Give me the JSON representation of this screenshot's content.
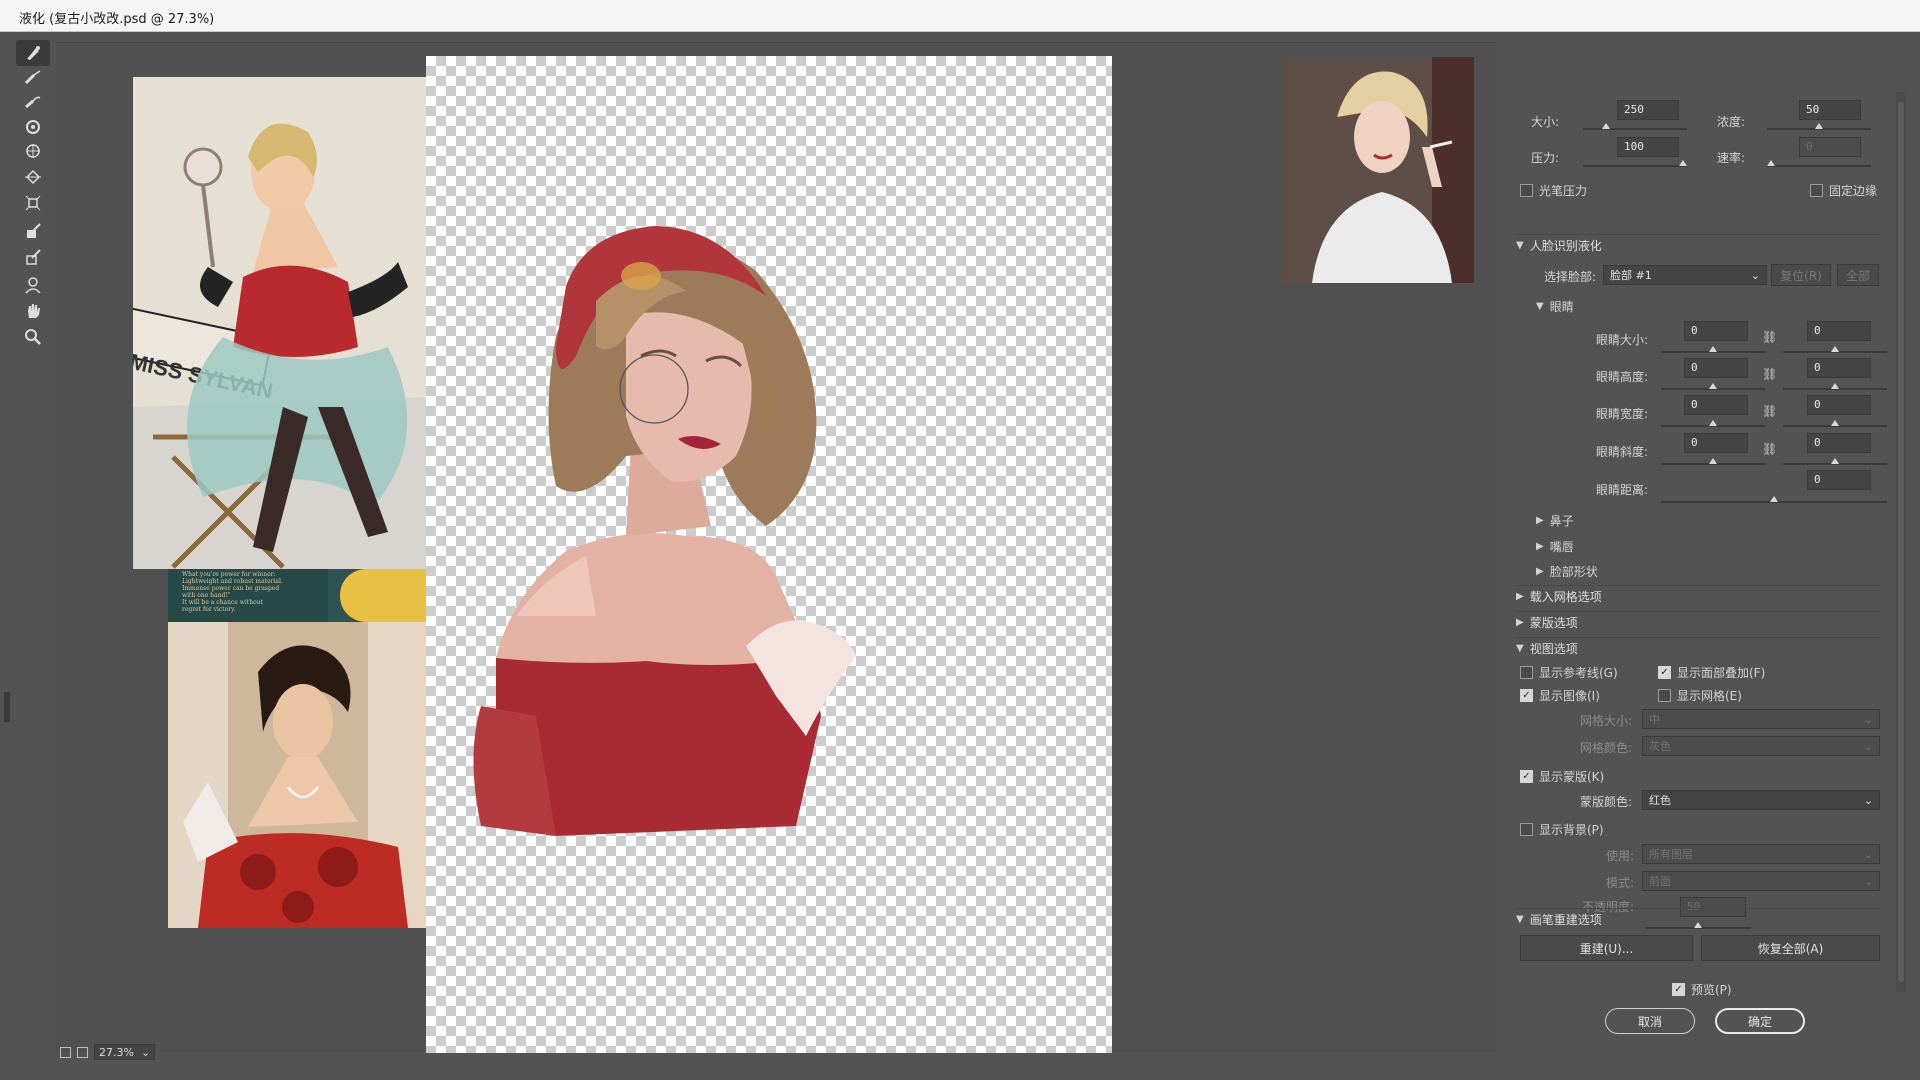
{
  "window": {
    "title": "液化 (复古小改改.psd @ 27.3%)"
  },
  "tools": [
    {
      "name": "forward-warp-tool"
    },
    {
      "name": "reconstruct-tool"
    },
    {
      "name": "smooth-tool"
    },
    {
      "name": "twirl-tool"
    },
    {
      "name": "pucker-tool"
    },
    {
      "name": "bloat-tool"
    },
    {
      "name": "push-left-tool"
    },
    {
      "name": "freeze-mask-tool"
    },
    {
      "name": "thaw-mask-tool"
    },
    {
      "name": "face-tool"
    },
    {
      "name": "hand-tool"
    },
    {
      "name": "zoom-tool"
    }
  ],
  "statusbar": {
    "zoom": "27.3%"
  },
  "brush": {
    "size_label": "大小:",
    "size_value": "250",
    "size_level": 0.2,
    "density_label": "浓度:",
    "density_value": "50",
    "density_level": 0.5,
    "pressure_label": "压力:",
    "pressure_value": "100",
    "pressure_level": 1.0,
    "rate_label": "速率:",
    "rate_value": "0",
    "rate_level": 0.0,
    "stylus_label": "光笔压力",
    "stylus_checked": false,
    "pin_edges_label": "固定边缘",
    "pin_edges_checked": false
  },
  "face": {
    "section": "人脸识别液化",
    "select_label": "选择脸部:",
    "select_value": "脸部 #1",
    "reset_label": "复位(R)",
    "all_label": "全部",
    "eyes_section": "眼睛",
    "eye_size_label": "眼睛大小:",
    "eye_size_left": "0",
    "eye_size_right": "0",
    "eye_height_label": "眼睛高度:",
    "eye_height_left": "0",
    "eye_height_right": "0",
    "eye_width_label": "眼睛宽度:",
    "eye_width_left": "0",
    "eye_width_right": "0",
    "eye_tilt_label": "眼睛斜度:",
    "eye_tilt_left": "0",
    "eye_tilt_right": "0",
    "eye_distance_label": "眼睛距离:",
    "eye_distance_value": "0",
    "nose": "鼻子",
    "mouth": "嘴唇",
    "face_shape": "脸部形状"
  },
  "mesh_section": "载入网格选项",
  "mask_section": "蒙版选项",
  "view": {
    "section": "视图选项",
    "guides_label": "显示参考线(G)",
    "guides_checked": false,
    "face_overlay_label": "显示面部叠加(F)",
    "face_overlay_checked": true,
    "image_label": "显示图像(I)",
    "image_checked": true,
    "mesh_label": "显示网格(E)",
    "mesh_checked": false,
    "mesh_size_label": "网格大小:",
    "mesh_size_value": "中",
    "mesh_color_label": "网格颜色:",
    "mesh_color_value": "灰色",
    "mask_label": "显示蒙版(K)",
    "mask_checked": true,
    "mask_color_label": "蒙版颜色:",
    "mask_color_value": "红色",
    "bg_label": "显示背景(P)",
    "bg_checked": false,
    "use_label": "使用:",
    "use_value": "所有图层",
    "mode_label": "模式:",
    "mode_value": "前面",
    "opacity_label": "不透明度:",
    "opacity_value": "50"
  },
  "reconstruct": {
    "section": "画笔重建选项",
    "rebuild_label": "重建(U)...",
    "restore_label": "恢复全部(A)"
  },
  "footer": {
    "preview_label": "预览(P)",
    "preview_checked": true,
    "cancel_label": "取消",
    "ok_label": "确定"
  },
  "reference_text": "What you're power for winner:\nLightweight and robust material.\nImmense power can be grasped\nwith one hand!\"\nIt will be a chance without\nregret for victory.",
  "chair_text": "MISS SYLVAN"
}
